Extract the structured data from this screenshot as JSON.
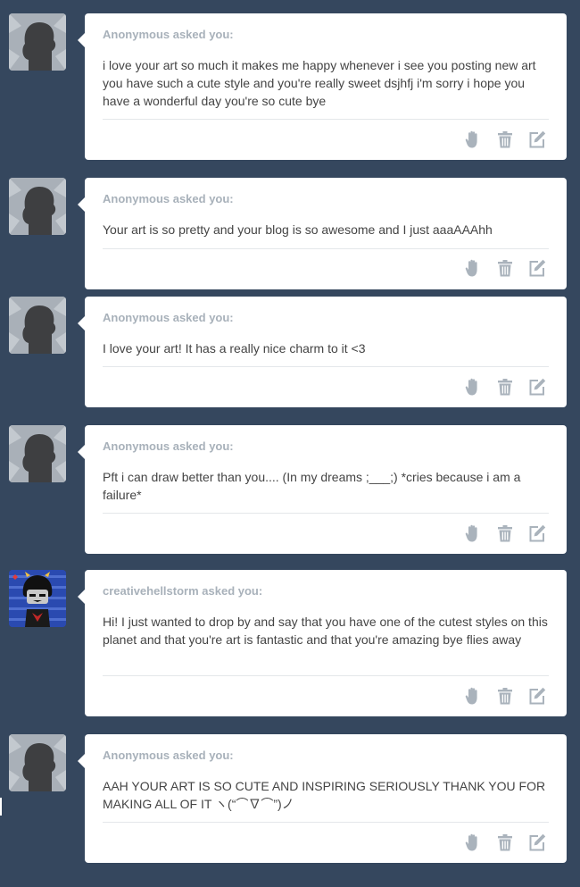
{
  "colors": {
    "background": "#35475e",
    "card": "#ffffff",
    "asker_text": "#a8b1ba",
    "body_text": "#444444",
    "icon": "#aab3bc"
  },
  "icons": {
    "ignore": "hand-icon",
    "delete": "trash-icon",
    "edit": "edit-icon",
    "default_avatar": "silhouette-avatar"
  },
  "posts": [
    {
      "asker": "Anonymous asked you:",
      "question": "i love your art so much it makes me happy whenever i see you posting new art you have such a cute style and you're really sweet dsjhfj i'm sorry i hope you have a wonderful day you're so cute bye"
    },
    {
      "asker": "Anonymous asked you:",
      "question": "Your art is so pretty and your blog is so awesome and I just aaaAAAhh"
    },
    {
      "asker": "Anonymous asked you:",
      "question": "I love your art! It has a really nice charm to it <3"
    },
    {
      "asker": "Anonymous asked you:",
      "question": "Pft i can draw better than you.... (In my dreams ;___;) *cries because i am a failure*"
    },
    {
      "asker": "creativehellstorm asked you:",
      "question": "Hi! I just wanted to drop by and say that you have one of the cutest styles on this planet and that you're art is fantastic and that you're amazing bye flies away"
    },
    {
      "asker": "Anonymous asked you:",
      "question": "AAH YOUR ART IS SO CUTE AND INSPIRING SERIOUSLY THANK YOU FOR MAKING ALL OF IT ヽ(“⌒∇⌒”)ノ"
    }
  ]
}
